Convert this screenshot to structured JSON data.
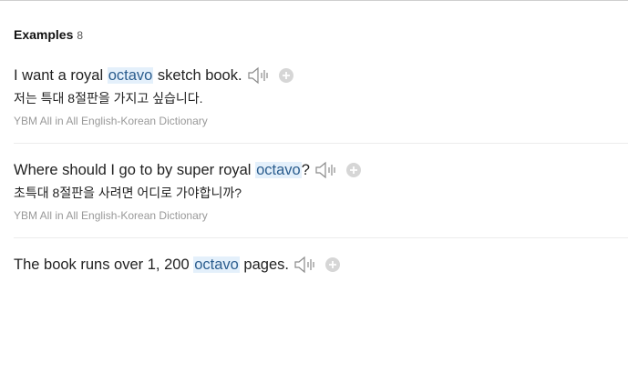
{
  "section": {
    "title": "Examples",
    "count": "8"
  },
  "examples": [
    {
      "before": "I want a royal ",
      "keyword": "octavo",
      "after": " sketch book.",
      "translation": "저는 특대 8절판을 가지고 싶습니다.",
      "source": "YBM All in All English-Korean Dictionary"
    },
    {
      "before": "Where should I go to by super royal ",
      "keyword": "octavo",
      "after": "?",
      "translation": "초특대 8절판을 사려면 어디로 가야합니까?",
      "source": "YBM All in All English-Korean Dictionary"
    },
    {
      "before": "The book runs over 1, 200 ",
      "keyword": "octavo",
      "after": " pages.",
      "translation": "",
      "source": ""
    }
  ],
  "icons": {
    "audio": "speaker-icon",
    "add": "plus-icon"
  },
  "colors": {
    "highlight_bg": "#e4f0fb",
    "highlight_text": "#2b5d8e",
    "source_text": "#999999"
  }
}
